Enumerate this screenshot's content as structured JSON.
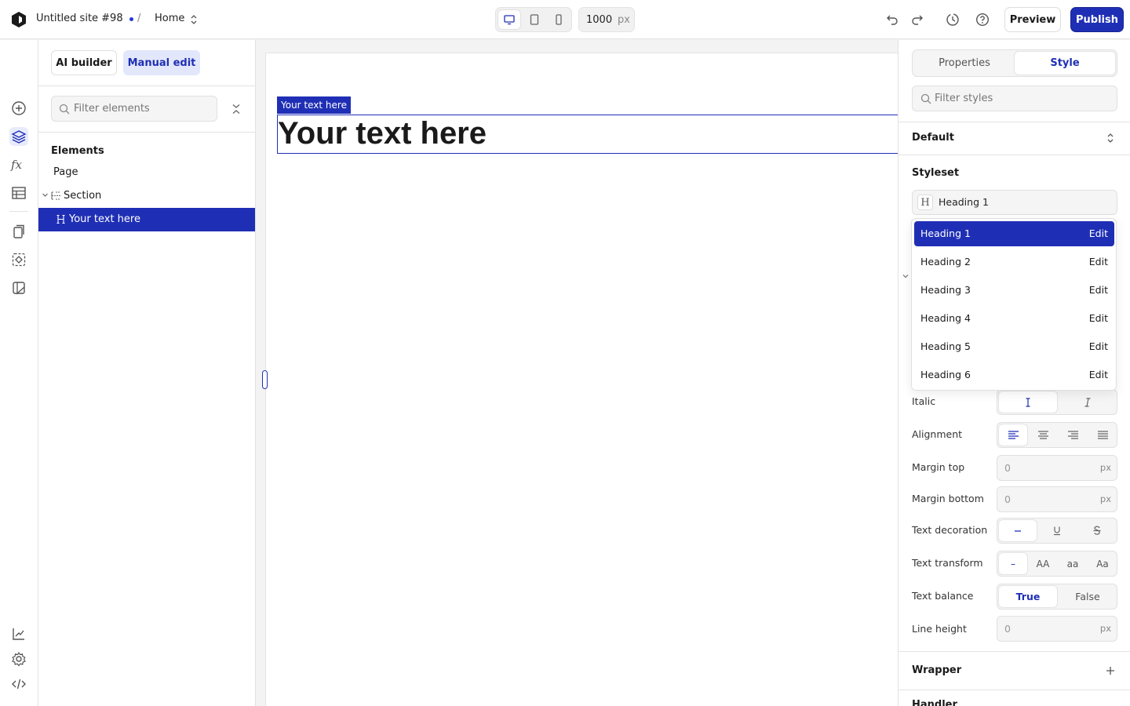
{
  "topbar": {
    "site_name": "Untitled site #98",
    "separator": "/",
    "page": "Home",
    "width_value": "1000",
    "width_unit": "px",
    "preview_label": "Preview",
    "publish_label": "Publish"
  },
  "panel": {
    "ai_builder_label": "AI builder",
    "manual_edit_label": "Manual edit",
    "filter_placeholder": "Filter elements",
    "elements_title": "Elements",
    "tree": {
      "page": "Page",
      "section": "Section",
      "text": "Your text here"
    }
  },
  "canvas": {
    "selection_tag": "Your text here",
    "heading_text": "Your text here"
  },
  "style_panel": {
    "tab_properties": "Properties",
    "tab_style": "Style",
    "filter_placeholder": "Filter styles",
    "default_title": "Default",
    "styleset_title": "Styleset",
    "styleset_value": "Heading 1",
    "styleset_options": [
      {
        "name": "Heading 1",
        "action": "Edit"
      },
      {
        "name": "Heading 2",
        "action": "Edit"
      },
      {
        "name": "Heading 3",
        "action": "Edit"
      },
      {
        "name": "Heading 4",
        "action": "Edit"
      },
      {
        "name": "Heading 5",
        "action": "Edit"
      },
      {
        "name": "Heading 6",
        "action": "Edit"
      }
    ],
    "italic_label": "Italic",
    "alignment_label": "Alignment",
    "margin_top_label": "Margin top",
    "margin_top_value": "0",
    "margin_bottom_label": "Margin bottom",
    "margin_bottom_value": "0",
    "text_decoration_label": "Text decoration",
    "text_transform_label": "Text transform",
    "text_transform_options": [
      "–",
      "AA",
      "aa",
      "Aa"
    ],
    "text_balance_label": "Text balance",
    "text_balance_true": "True",
    "text_balance_false": "False",
    "line_height_label": "Line height",
    "line_height_value": "0",
    "unit": "px",
    "wrapper_title": "Wrapper",
    "next_title": "Handler"
  },
  "colors": {
    "accent": "#1f2fb5",
    "accent_light": "#e3e7fb"
  }
}
